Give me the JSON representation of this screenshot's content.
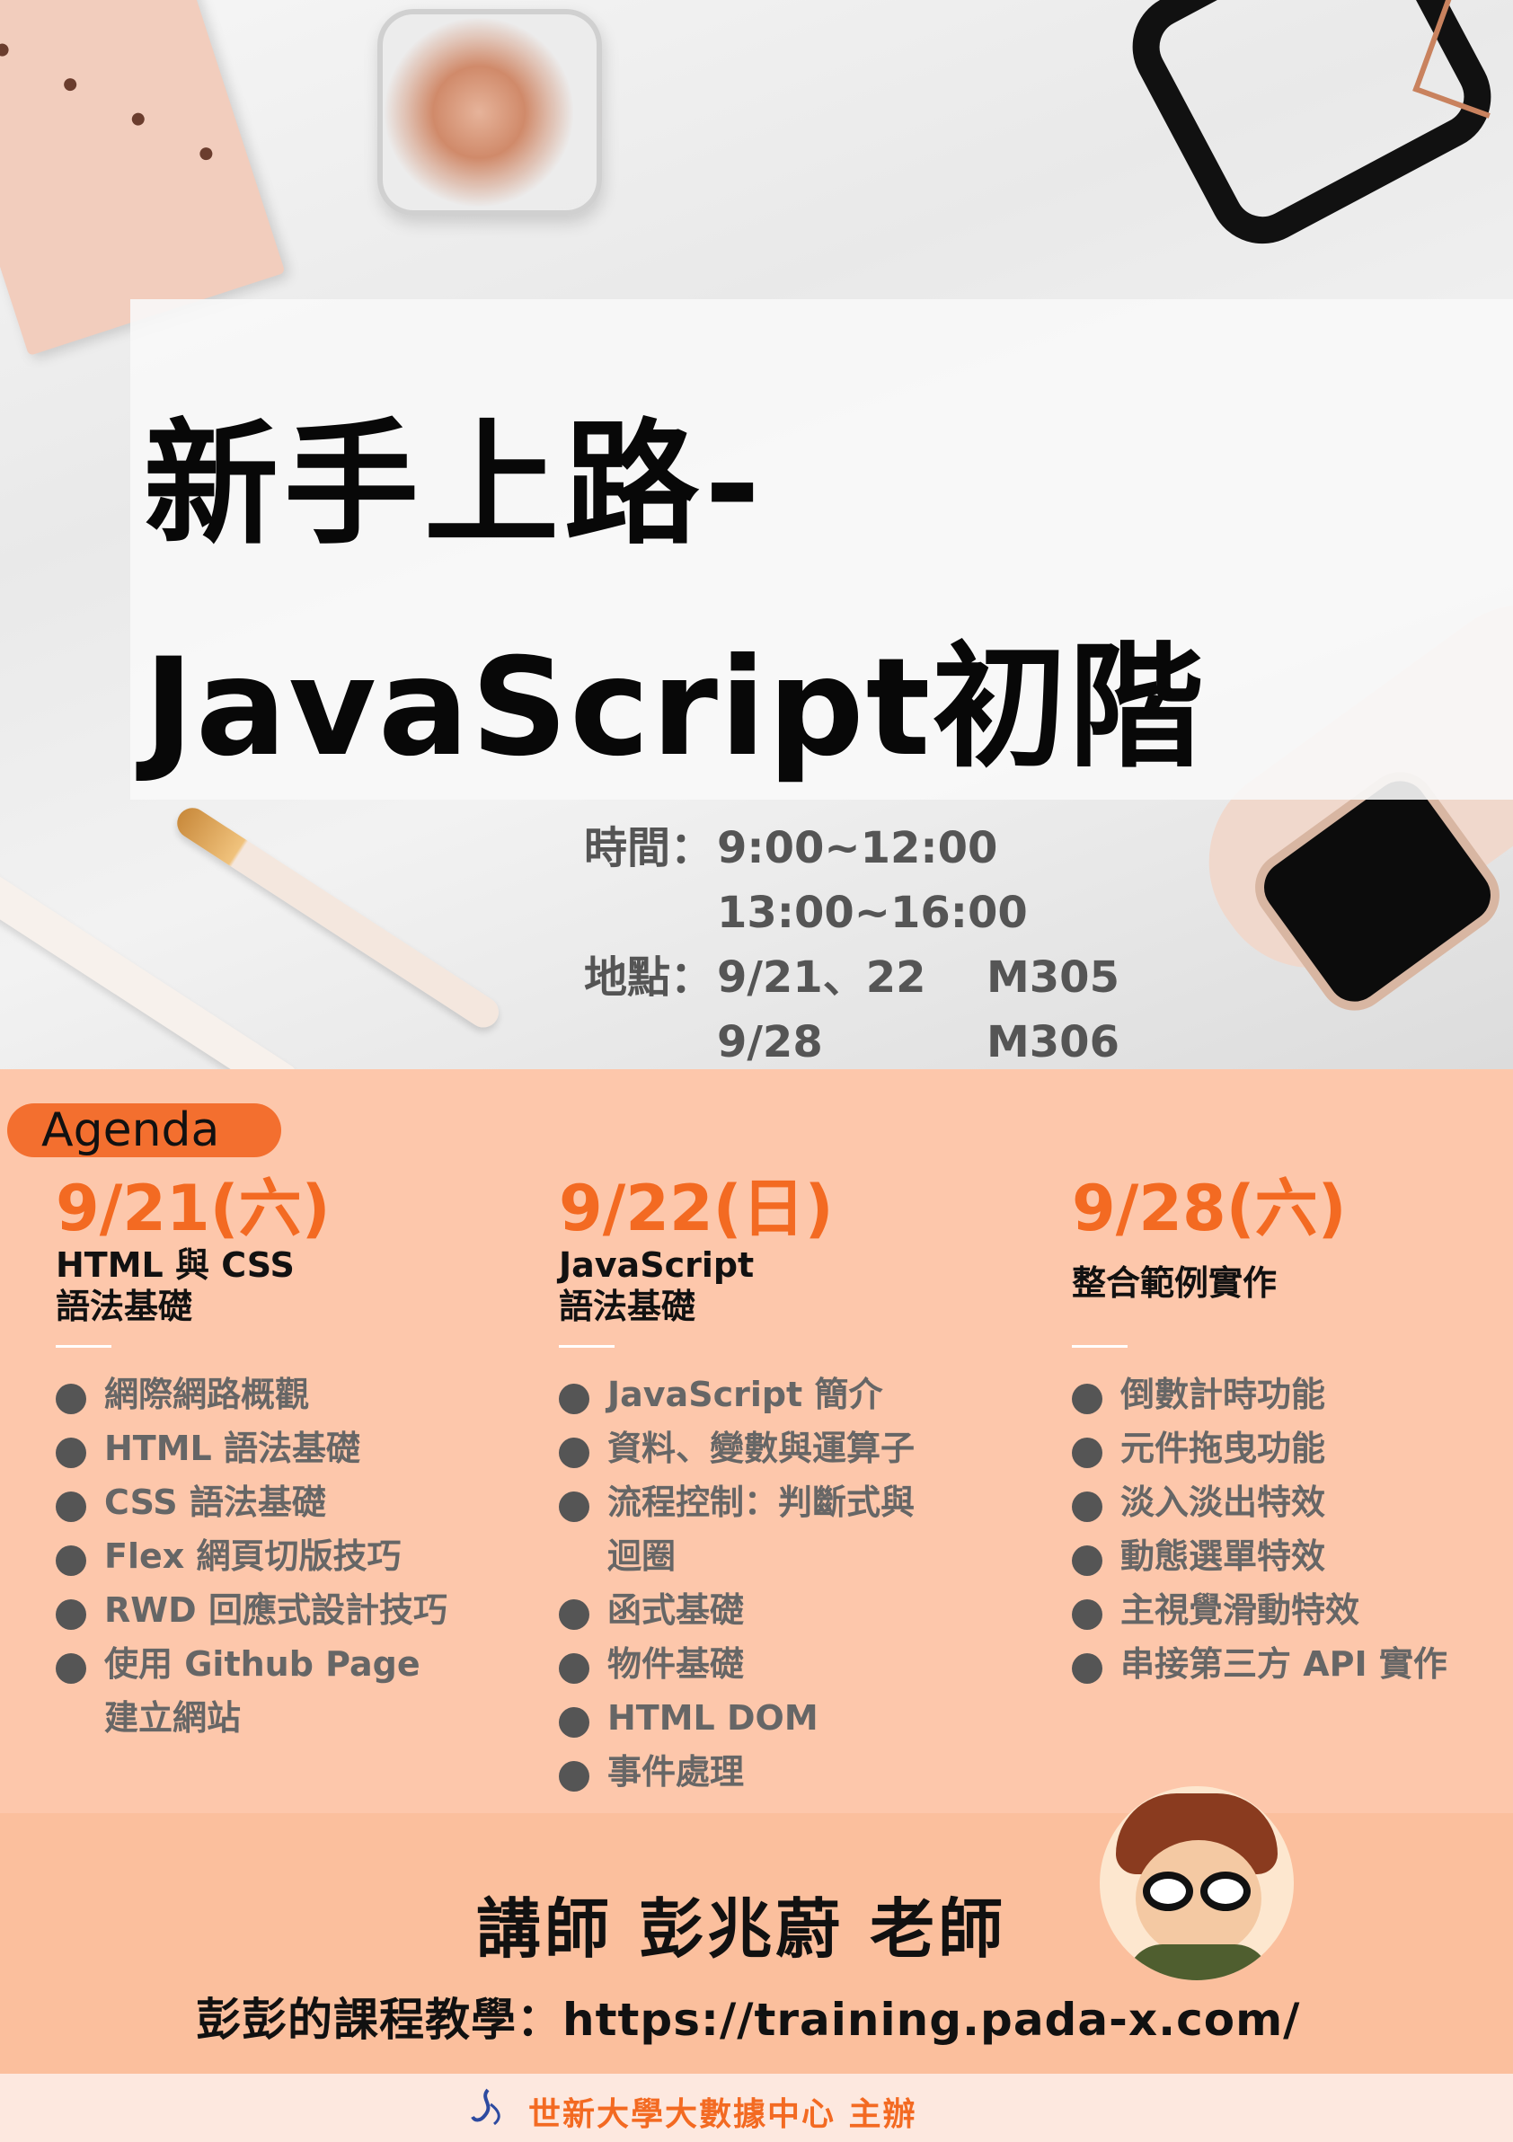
{
  "title": {
    "line1": "新手上路-",
    "line2": "JavaScript初階"
  },
  "info": {
    "time_label": "時間：",
    "time_1": "9:00~12:00",
    "time_2": "13:00~16:00",
    "place_label": "地點：",
    "place_1_dates": "9/21、22",
    "place_1_room": "M305",
    "place_2_dates": "9/28",
    "place_2_room": "M306"
  },
  "agenda": {
    "tag": "Agenda",
    "days": [
      {
        "date": "9/21(六)",
        "subtitle_1": "HTML 與 CSS",
        "subtitle_2": "語法基礎",
        "items": [
          "網際網路概觀",
          "HTML 語法基礎",
          "CSS 語法基礎",
          "Flex 網頁切版技巧",
          "RWD 回應式設計技巧",
          "使用 Github Page",
          "建立網站"
        ]
      },
      {
        "date": "9/22(日)",
        "subtitle_1": "JavaScript",
        "subtitle_2": "語法基礎",
        "items": [
          "JavaScript 簡介",
          "資料、變數與運算子",
          "流程控制：判斷式與",
          "迴圈",
          "函式基礎",
          "物件基礎",
          "HTML DOM",
          "事件處理"
        ]
      },
      {
        "date": "9/28(六)",
        "subtitle_1": "整合範例實作",
        "subtitle_2": "",
        "items": [
          "倒數計時功能",
          "元件拖曳功能",
          "淡入淡出特效",
          "動態選單特效",
          "主視覺滑動特效",
          "串接第三方 API 實作"
        ]
      }
    ]
  },
  "instructor": {
    "title": "講師 彭兆蔚 老師",
    "site": "彭彭的課程教學：https://training.pada-x.com/"
  },
  "footer": {
    "organizer": "世新大學大數據中心 主辦"
  },
  "colors": {
    "agenda_bg": "#fdc7ab",
    "accent": "#f36a22",
    "tag_bg": "#f36f2f",
    "instructor_bg": "#fbbf9d"
  }
}
